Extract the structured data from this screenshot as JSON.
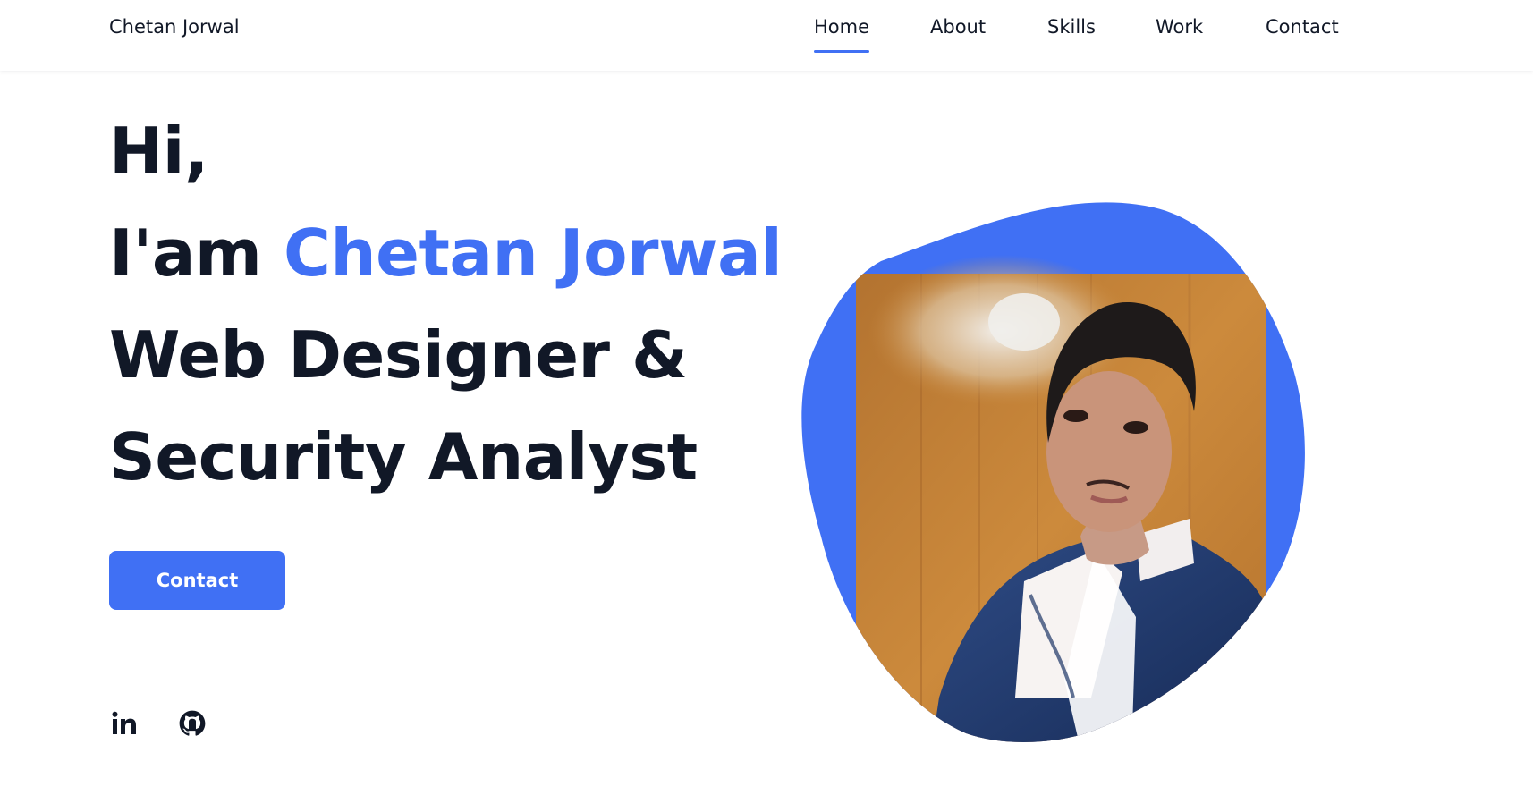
{
  "colors": {
    "accent": "#4070f4",
    "text": "#111827",
    "background": "#ffffff",
    "button_text": "#ffffff"
  },
  "header": {
    "brand": "Chetan Jorwal",
    "nav": [
      {
        "label": "Home",
        "active": true
      },
      {
        "label": "About",
        "active": false
      },
      {
        "label": "Skills",
        "active": false
      },
      {
        "label": "Work",
        "active": false
      },
      {
        "label": "Contact",
        "active": false
      }
    ]
  },
  "hero": {
    "greeting": "Hi,",
    "intro_prefix": "I'am",
    "name": "Chetan Jorwal",
    "role_line1": "Web Designer &",
    "role_line2": "Security Analyst",
    "cta_label": "Contact"
  },
  "social": [
    {
      "icon": "linkedin-icon"
    },
    {
      "icon": "github-icon"
    }
  ],
  "profile_image": {
    "icon": "profile-photo",
    "shape": "blob"
  }
}
